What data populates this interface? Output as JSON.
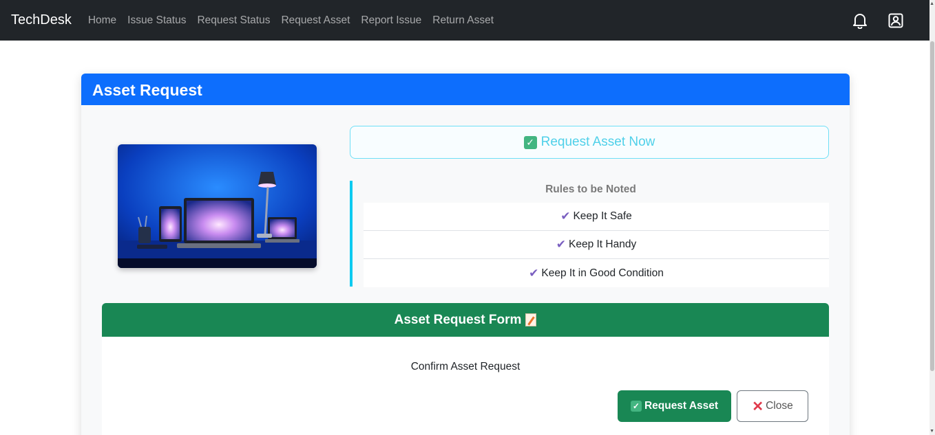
{
  "navbar": {
    "brand": "TechDesk",
    "links": [
      "Home",
      "Issue Status",
      "Request Status",
      "Request Asset",
      "Report Issue",
      "Return Asset"
    ],
    "icons": [
      "bell-icon",
      "user-profile-icon"
    ]
  },
  "card": {
    "title": "Asset Request",
    "image_icon": "devices-photo",
    "cta_label": "Request Asset Now",
    "rules": {
      "title": "Rules to be Noted",
      "items": [
        "Keep It Safe",
        "Keep It Handy",
        "Keep It in Good Condition"
      ]
    }
  },
  "form": {
    "title": "Asset Request Form",
    "confirm_text": "Confirm Asset Request",
    "submit_label": "Request Asset",
    "close_label": "Close"
  },
  "colors": {
    "navbar": "#212529",
    "primary": "#0d6efd",
    "success": "#198754",
    "info": "#0dcaf0"
  }
}
